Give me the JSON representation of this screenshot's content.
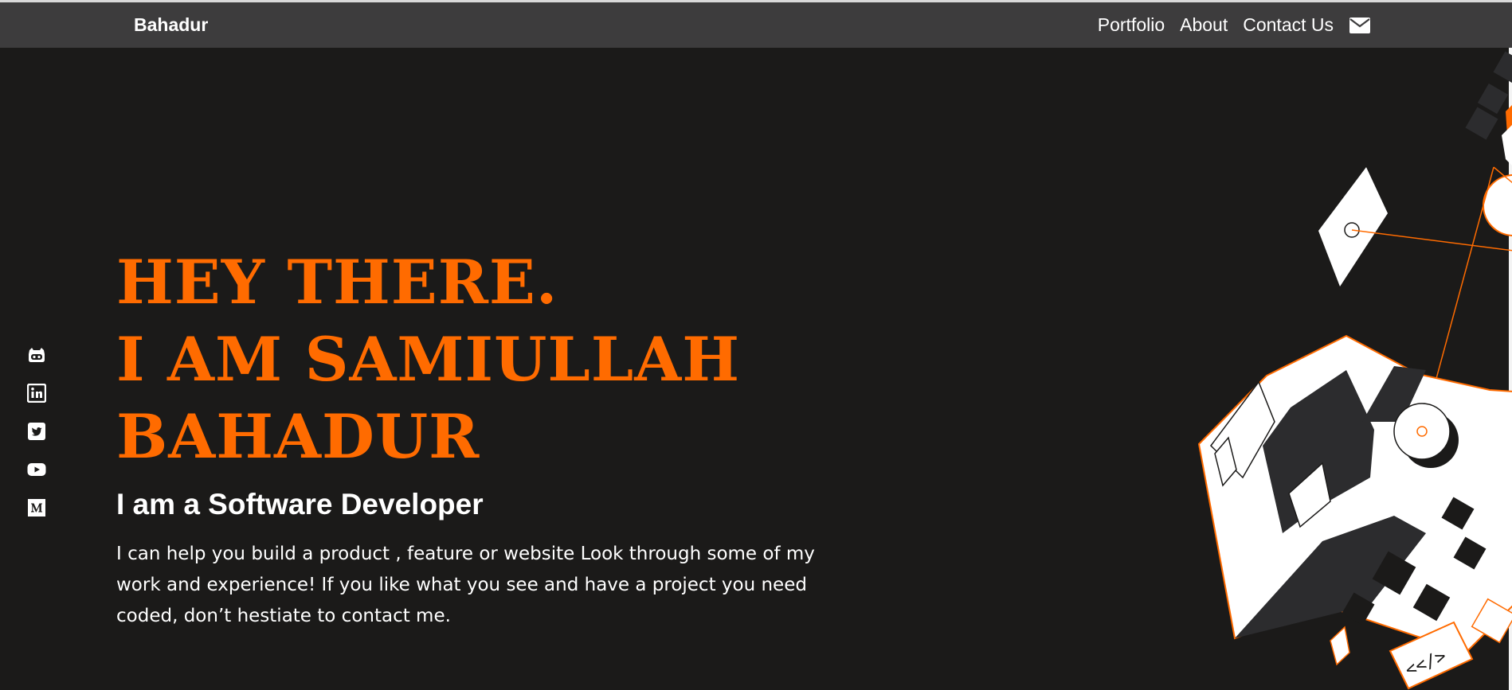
{
  "nav": {
    "brand": "Bahadur",
    "links": [
      "Portfolio",
      "About",
      "Contact Us"
    ],
    "contact_icon": "envelope-icon"
  },
  "social_icons": [
    "github-icon",
    "linkedin-icon",
    "twitter-icon",
    "youtube-icon",
    "medium-icon"
  ],
  "hero": {
    "headline_lines": [
      "HEY THERE.",
      "I AM SAMIULLAH",
      "BAHADUR"
    ],
    "subtitle": "I am a Software Developer",
    "description": "I can help you build a product , feature or website Look through some of my work and experience! If you like what you see and have a project you need coded, don’t hestiate to contact me."
  },
  "illustration": {
    "code_tag": "<</>"
  },
  "colors": {
    "accent": "#ff6b00",
    "background": "#1b1a19",
    "navbar": "#3d3c3d",
    "text": "#ffffff"
  }
}
